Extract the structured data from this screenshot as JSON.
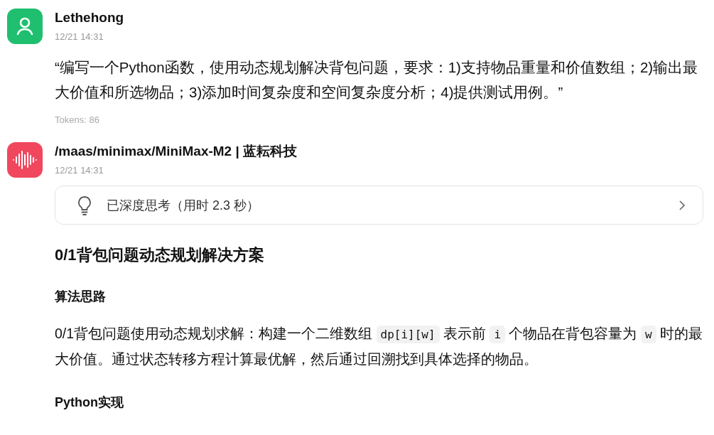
{
  "messages": [
    {
      "kind": "user",
      "author": "Lethehong",
      "time": "12/21 14:31",
      "text": "“编写一个Python函数，使用动态规划解决背包问题，要求：1)支持物品重量和价值数组；2)输出最大价值和所选物品；3)添加时间复杂度和空间复杂度分析；4)提供测试用例。”",
      "tokens": "Tokens: 86"
    },
    {
      "kind": "assistant",
      "author": "/maas/minimax/MiniMax-M2 | 蓝耘科技",
      "time": "12/21 14:31",
      "thinking": {
        "label": "已深度思考（用时 2.3 秒）",
        "expanded": false
      },
      "blocks": [
        {
          "kind": "h2",
          "text": "0/1背包问题动态规划解决方案"
        },
        {
          "kind": "h3",
          "text": "算法思路"
        },
        {
          "kind": "p",
          "segments": [
            {
              "kind": "text",
              "text": "0/1背包问题使用动态规划求解：构建一个二维数组 "
            },
            {
              "kind": "code",
              "text": "dp[i][w]"
            },
            {
              "kind": "text",
              "text": " 表示前 "
            },
            {
              "kind": "code",
              "text": "i"
            },
            {
              "kind": "text",
              "text": " 个物品在背包容量为 "
            },
            {
              "kind": "code",
              "text": "w"
            },
            {
              "kind": "text",
              "text": " 时的最大价值。通过状态转移方程计算最优解，然后通过回溯找到具体选择的物品。"
            }
          ]
        },
        {
          "kind": "h3",
          "text": "Python实现"
        }
      ]
    }
  ]
}
